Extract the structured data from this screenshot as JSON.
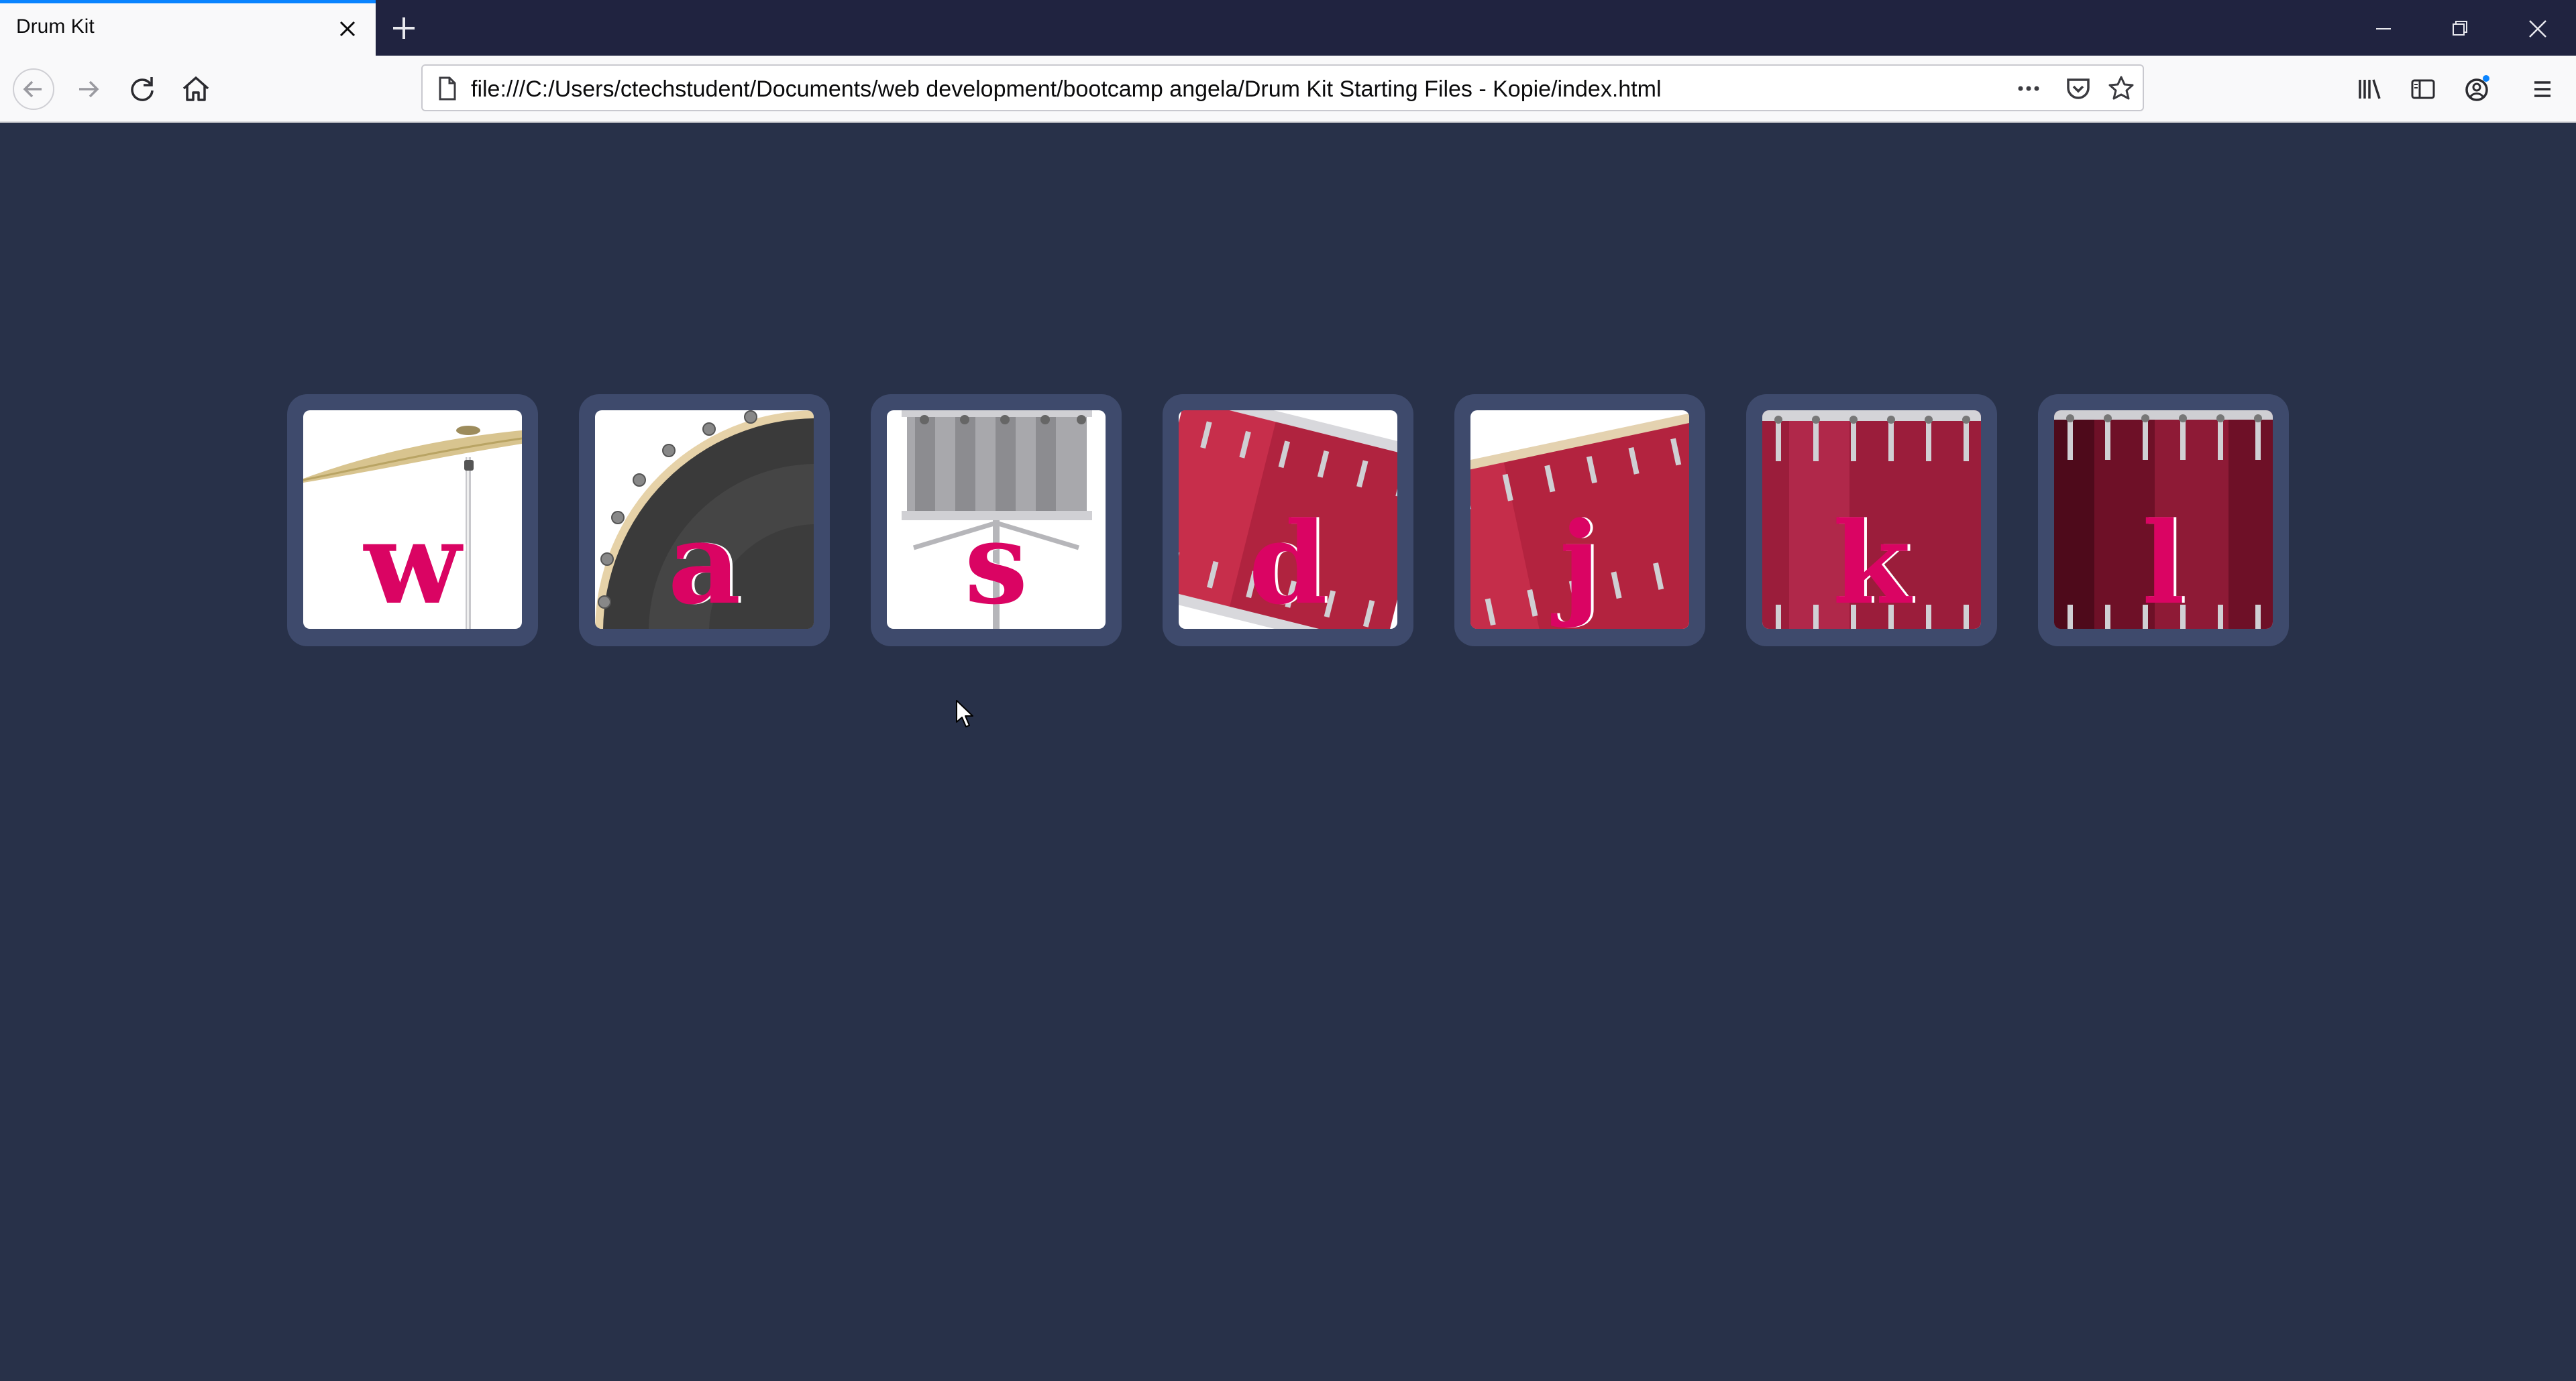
{
  "browser": {
    "tab_title": "Drum Kit",
    "url": "file:///C:/Users/ctechstudent/Documents/web development/bootcamp angela/Drum Kit Starting Files - Kopie/index.html",
    "icons": [
      "close-icon",
      "plus-icon",
      "minimize-icon",
      "restore-icon",
      "window-close-icon",
      "back-arrow-icon",
      "forward-arrow-icon",
      "reload-icon",
      "home-icon",
      "page-icon",
      "more-icon",
      "pocket-icon",
      "star-icon",
      "library-icon",
      "sidebar-icon",
      "account-icon",
      "menu-icon"
    ]
  },
  "page": {
    "background": "#283149",
    "accent": "#da0463",
    "drums": [
      {
        "key": "w",
        "image": "crash cymbal"
      },
      {
        "key": "a",
        "image": "kick bass"
      },
      {
        "key": "s",
        "image": "snare"
      },
      {
        "key": "d",
        "image": "tom 1"
      },
      {
        "key": "j",
        "image": "tom 2"
      },
      {
        "key": "k",
        "image": "tom 3"
      },
      {
        "key": "l",
        "image": "tom 4"
      }
    ]
  }
}
